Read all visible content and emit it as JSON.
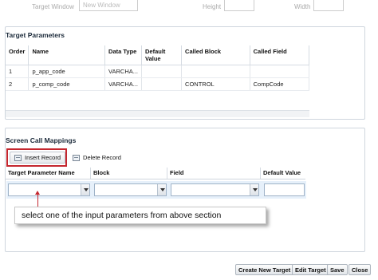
{
  "top_row": {
    "target_window_label": "Target Window",
    "target_window_value": "New Window",
    "height_label": "Height",
    "width_label": "Width"
  },
  "target_parameters": {
    "title": "Target Parameters",
    "columns": [
      "Order",
      "Name",
      "Data Type",
      "Default Value",
      "Called Block",
      "Called Field"
    ],
    "rows": [
      [
        "1",
        "p_app_code",
        "VARCHA...",
        "",
        "",
        ""
      ],
      [
        "2",
        "p_comp_code",
        "VARCHA...",
        "",
        "CONTROL",
        "CompCode"
      ]
    ]
  },
  "screen_call_mappings": {
    "title": "Screen Call Mappings",
    "insert_label": "Insert Record",
    "delete_label": "Delete Record",
    "columns": [
      "Target Parameter Name",
      "Block",
      "Field",
      "Default Value"
    ]
  },
  "callout_text": "select one of the input parameters from above section",
  "footer": {
    "create_label": "Create New Target",
    "edit_label": "Edit Target",
    "save_label": "Save",
    "close_label": "Close"
  },
  "colors": {
    "highlight_red": "#c4262e",
    "panel_border": "#cfd6de",
    "row_highlight": "#e6f0fa"
  }
}
